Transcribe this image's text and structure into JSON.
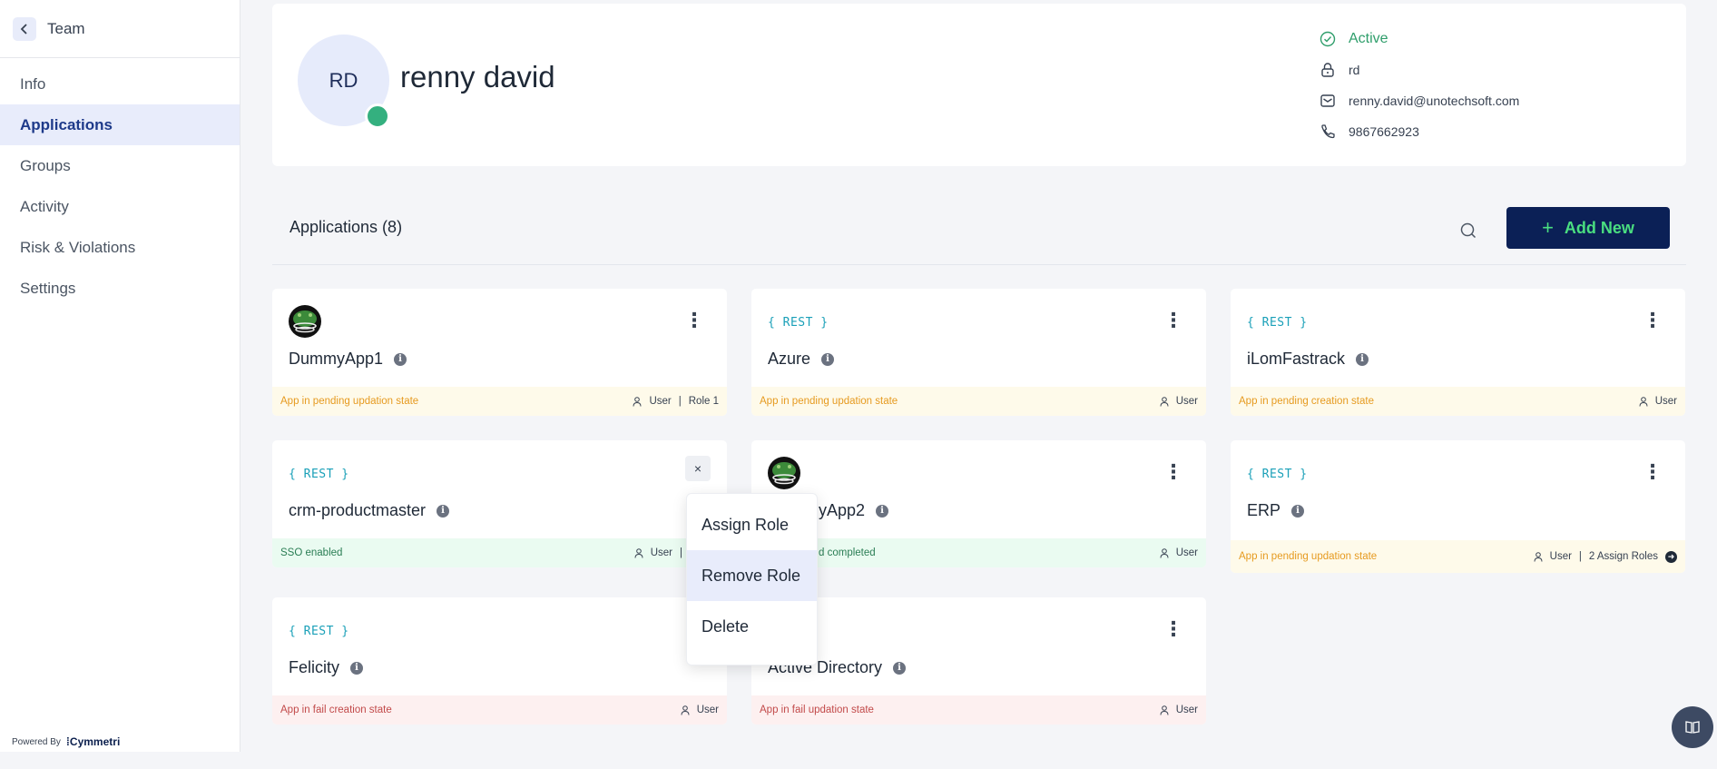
{
  "sidebar": {
    "title": "Team",
    "items": [
      {
        "label": "Info"
      },
      {
        "label": "Applications"
      },
      {
        "label": "Groups"
      },
      {
        "label": "Activity"
      },
      {
        "label": "Risk & Violations"
      },
      {
        "label": "Settings"
      }
    ],
    "active_item": "Applications",
    "powered_by": "Powered By",
    "brand": "Cymmetri"
  },
  "profile": {
    "initials": "RD",
    "name": "renny david",
    "status": "Active",
    "username": "rd",
    "email": "renny.david@unotechsoft.com",
    "phone": "9867662923"
  },
  "applications": {
    "title": "Applications (8)",
    "add_button": "Add New",
    "rest_badge": "{ REST }",
    "cards": [
      {
        "name": "DummyApp1",
        "logo": "frog-icon",
        "status": "App in pending updation state",
        "status_color": "yellow",
        "role": "User",
        "extra": "Role 1"
      },
      {
        "name": "Azure",
        "logo": "rest",
        "status": "App in pending updation state",
        "status_color": "yellow",
        "role": "User",
        "extra": ""
      },
      {
        "name": "iLomFastrack",
        "logo": "rest",
        "status": "App in pending creation state",
        "status_color": "yellow",
        "role": "User",
        "extra": ""
      },
      {
        "name": "crm-productmaster",
        "logo": "rest",
        "status": "SSO enabled",
        "status_color": "green",
        "role": "User",
        "extra": ""
      },
      {
        "name": "yApp2",
        "logo": "frog-icon",
        "status": "d completed",
        "status_color": "green",
        "role": "User",
        "extra": ""
      },
      {
        "name": "ERP",
        "logo": "rest",
        "status": "App in pending updation state",
        "status_color": "yellow",
        "role": "User",
        "extra": "2 Assign Roles"
      },
      {
        "name": "Felicity",
        "logo": "rest",
        "status": "App in fail creation state",
        "status_color": "red",
        "role": "User",
        "extra": ""
      },
      {
        "name": "Active Directory",
        "logo": "none",
        "status": "App in fail updation state",
        "status_color": "red",
        "role": "User",
        "extra": ""
      }
    ]
  },
  "context_menu": {
    "items": [
      "Assign Role",
      "Remove Role",
      "Delete"
    ],
    "highlighted": "Remove Role",
    "close_label": "×"
  },
  "colors": {
    "primary": "#0b2056",
    "accent_green": "#4ade80",
    "active_nav_bg": "#e8ecfb",
    "status_active": "#2f9e6b"
  }
}
